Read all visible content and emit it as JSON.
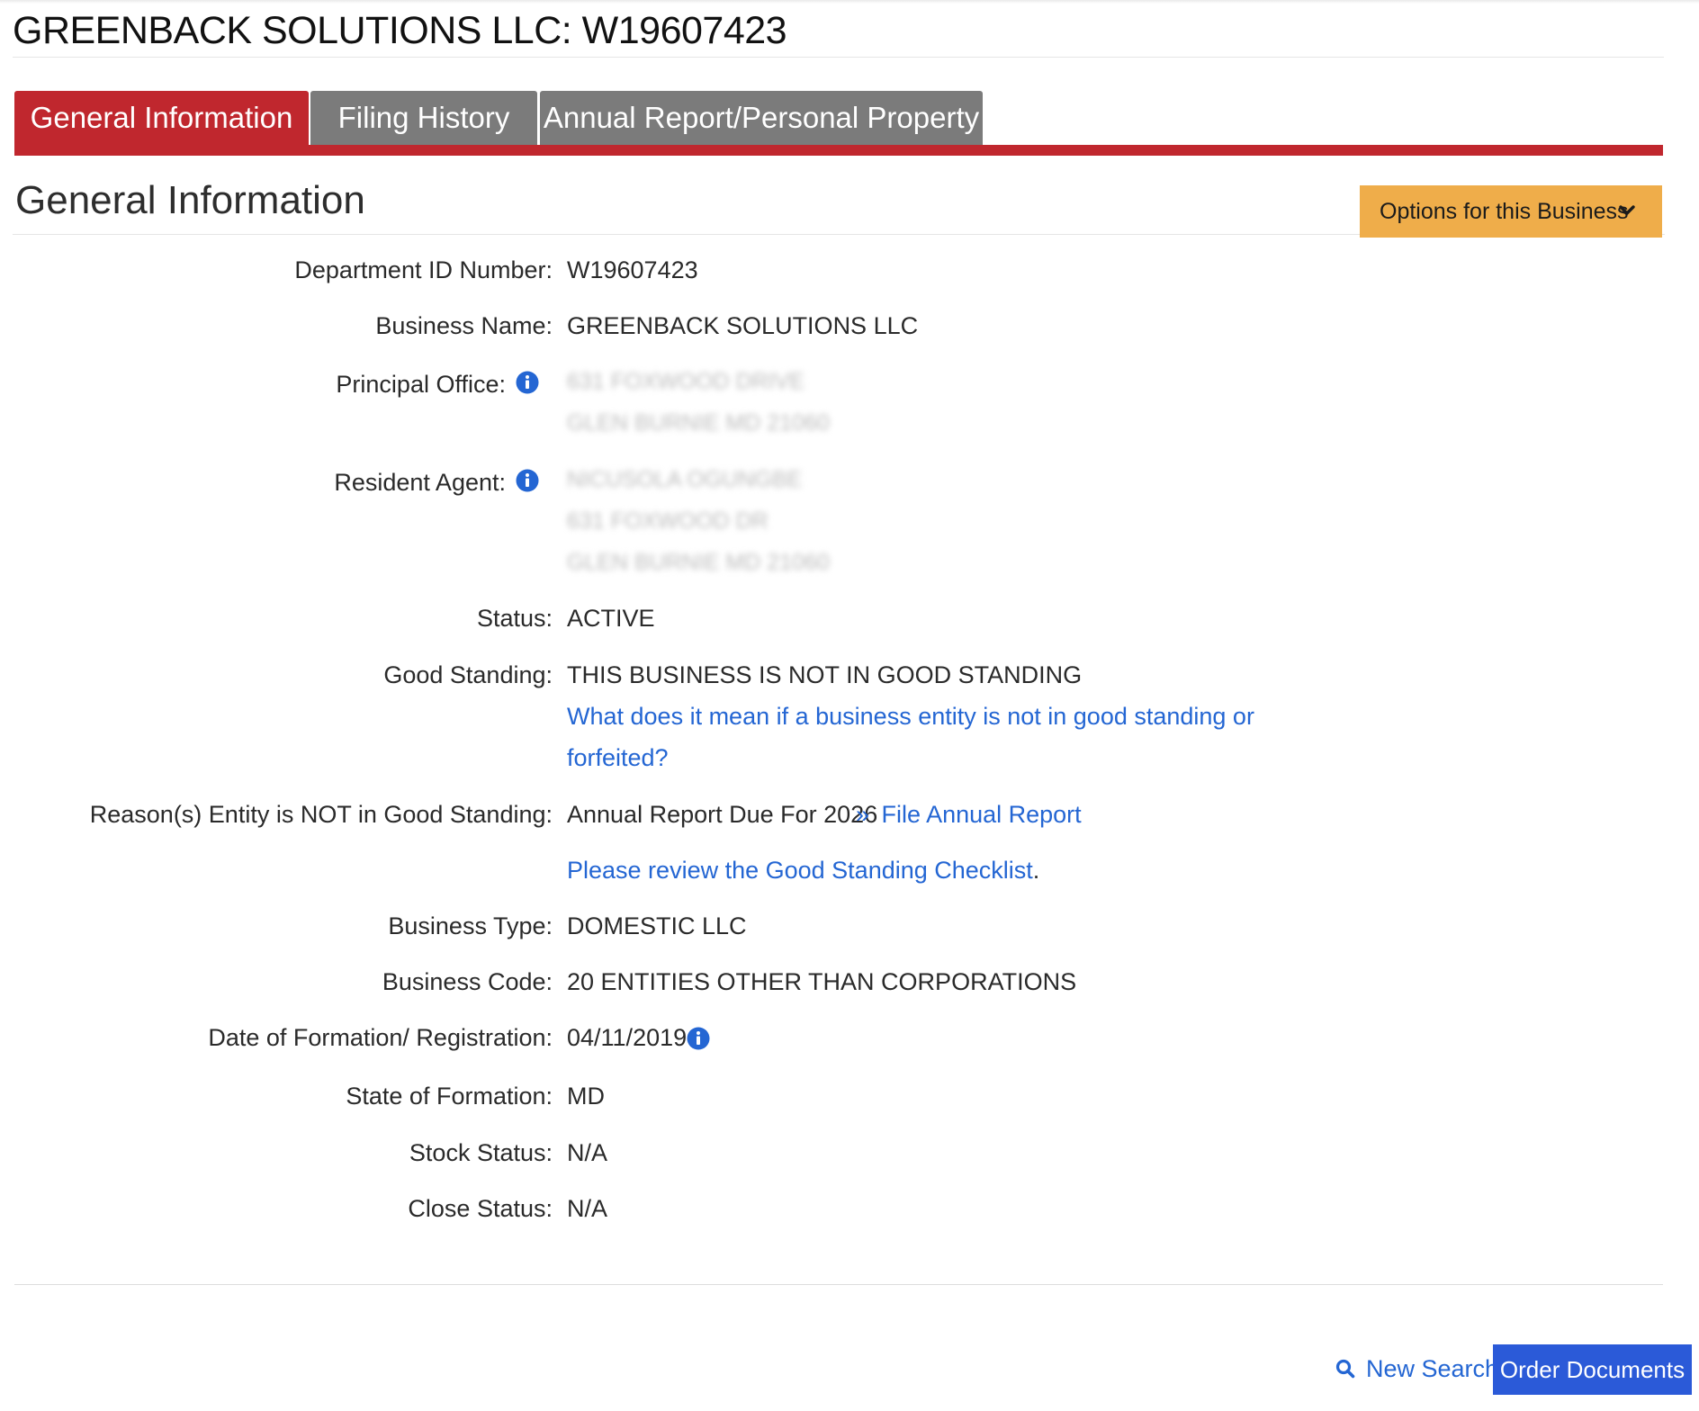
{
  "page": {
    "entity_title": "GREENBACK SOLUTIONS LLC: W19607423"
  },
  "tabs": [
    {
      "label": "General Information",
      "active": true
    },
    {
      "label": "Filing History",
      "active": false
    },
    {
      "label": "Annual Report/Personal Property",
      "active": false
    }
  ],
  "section": {
    "title": "General Information",
    "options_button": "Options for this Business",
    "options_icon": "chevron-down-icon"
  },
  "info": {
    "department_id": {
      "label": "Department ID Number:",
      "value": "W19607423"
    },
    "business_name": {
      "label": "Business Name:",
      "value": "GREENBACK SOLUTIONS LLC"
    },
    "principal_office": {
      "label": "Principal Office:",
      "lines": [
        "631 FOXWOOD DRIVE",
        "GLEN BURNIE MD 21060"
      ]
    },
    "resident_agent": {
      "label": "Resident Agent:",
      "lines": [
        "NICUSOLA OGUNGBE",
        "631 FOXWOOD DR",
        "GLEN BURNIE MD 21060"
      ]
    },
    "status": {
      "label": "Status:",
      "value": "ACTIVE"
    },
    "good_standing": {
      "label": "Good Standing:",
      "value": "THIS BUSINESS IS NOT IN GOOD STANDING",
      "help_link_line1": "What does it mean if a business entity is not in good standing or",
      "help_link_line2": "forfeited?"
    },
    "reasons": {
      "label": "Reason(s) Entity is NOT in Good Standing:",
      "value": "Annual Report Due For 2026",
      "file_link_prefix": "»",
      "file_link": "File Annual Report",
      "checklist_link": "Please review the Good Standing Checklist",
      "checklist_suffix": "."
    },
    "business_type": {
      "label": "Business Type:",
      "value": "DOMESTIC LLC"
    },
    "business_code": {
      "label": "Business Code:",
      "value": "20 ENTITIES OTHER THAN CORPORATIONS"
    },
    "formation_date": {
      "label": "Date of Formation/ Registration:",
      "value": "04/11/2019"
    },
    "state_of_formation": {
      "label": "State of Formation:",
      "value": "MD"
    },
    "stock_status": {
      "label": "Stock Status:",
      "value": "N/A"
    },
    "close_status": {
      "label": "Close Status:",
      "value": "N/A"
    }
  },
  "footer": {
    "new_search": "New Search",
    "order_documents": "Order Documents"
  },
  "colors": {
    "tab_active": "#c0272e",
    "tab_inactive": "#7b7b7b",
    "options_button": "#efad4a",
    "link": "#2466d3",
    "order_button": "#2b5ad8"
  }
}
